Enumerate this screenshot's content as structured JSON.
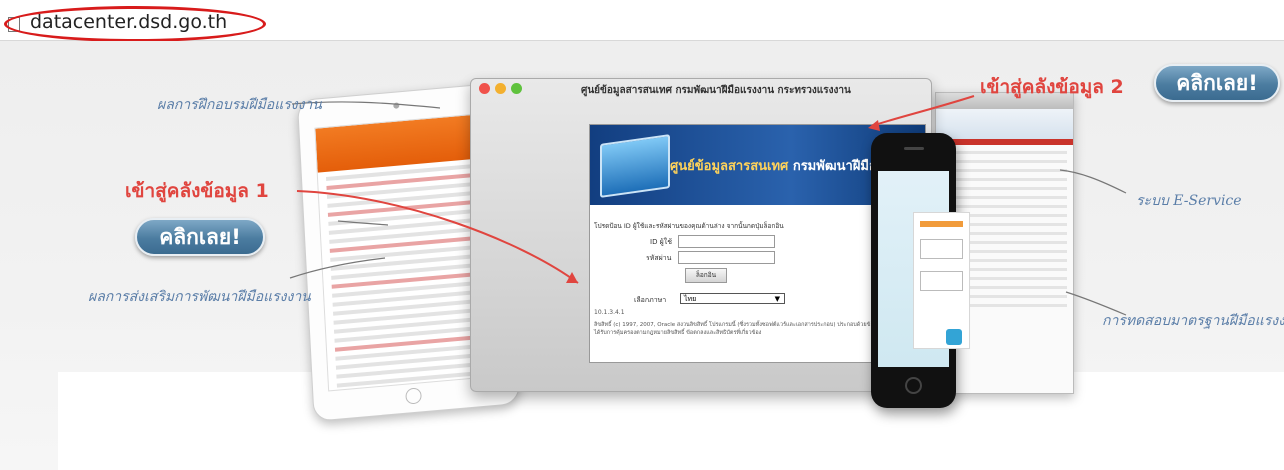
{
  "browser": {
    "url": "datacenter.dsd.go.th"
  },
  "annotations": {
    "training_results": "ผลการฝึกอบรมฝีมือแรงงาน",
    "promotion_results": "ผลการส่งเสริมการพัฒนาฝีมือแรงงาน",
    "eservice": "ระบบ E-Service",
    "skill_standard": "การทดสอบมาตรฐานฝีมือแรงงาน",
    "datacenter_1": "เข้าสู่คลังข้อมูล 1",
    "datacenter_2": "เข้าสู่คลังข้อมูล 2",
    "click_now": "คลิกเลย!"
  },
  "main_window": {
    "title": "ศูนย์ข้อมูลสารสนเทศ กรมพัฒนาฝีมือแรงงาน กระทรวงแรงงาน",
    "banner_text_a": "ศูนย์ข้อมูลสารสนเทศ",
    "banner_text_b": "กรมพัฒนาฝีมือแรงงาน",
    "login_note": "โปรดป้อน ID ผู้ใช้และรหัสผ่านของคุณด้านล่าง จากนั้นกดปุ่มล็อกอิน",
    "user_id_label": "ID ผู้ใช้",
    "password_label": "รหัสผ่าน",
    "login_button": "ล็อกอิน",
    "language_label": "เลือกภาษา",
    "language_value": "ไทย",
    "version": "10.1.3.4.1",
    "copyright": "ลิขสิทธิ์ (c) 1997, 2007, Oracle สงวนลิขสิทธิ์ โปรแกรมนี้ (ซึ่งรวมทั้งซอฟต์แวร์และเอกสารประกอบ) ประกอบด้วยข้อมูลที่เป็นความลับซึ่งได้รับการคุ้มครองตามกฎหมายลิขสิทธิ์ ข้อตกลงและสิทธิบัตรที่เกี่ยวข้อง"
  }
}
